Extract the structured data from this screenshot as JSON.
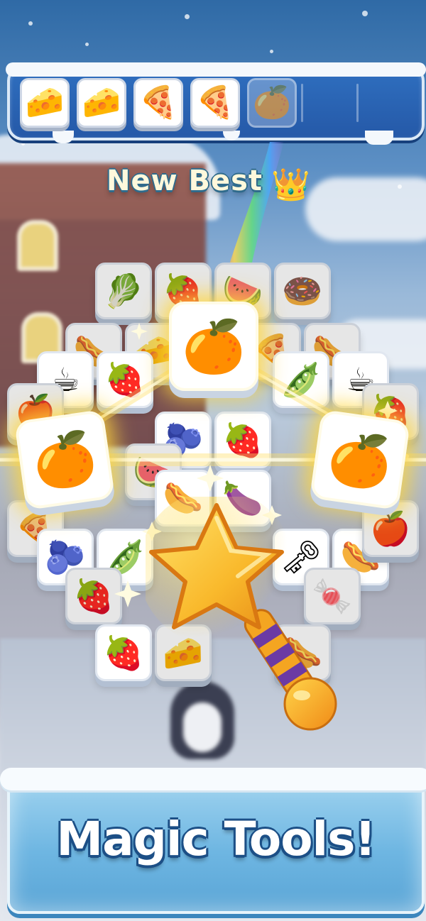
{
  "tray": {
    "slots": [
      {
        "icon": "cheese",
        "glyph": "🧀",
        "state": "filled"
      },
      {
        "icon": "cheese",
        "glyph": "🧀",
        "state": "filled"
      },
      {
        "icon": "pizza",
        "glyph": "🍕",
        "state": "filled"
      },
      {
        "icon": "pizza",
        "glyph": "🍕",
        "state": "filled"
      },
      {
        "icon": "orange",
        "glyph": "🍊",
        "state": "incoming"
      },
      {
        "icon": "empty",
        "glyph": "",
        "state": "empty"
      },
      {
        "icon": "empty",
        "glyph": "",
        "state": "empty"
      }
    ]
  },
  "new_best": {
    "label": "New Best",
    "icon": "crown",
    "glyph": "👑"
  },
  "tiles": [
    {
      "icon": "lettuce",
      "glyph": "🥬"
    },
    {
      "icon": "strawberry",
      "glyph": "🍓"
    },
    {
      "icon": "watermelon",
      "glyph": "🍉"
    },
    {
      "icon": "donut",
      "glyph": "🍩"
    },
    {
      "icon": "hotdog",
      "glyph": "🌭"
    },
    {
      "icon": "cheese",
      "glyph": "🧀"
    },
    {
      "icon": "pizza",
      "glyph": "🍕"
    },
    {
      "icon": "hotdog",
      "glyph": "🌭"
    },
    {
      "icon": "coffee",
      "glyph": "☕"
    },
    {
      "icon": "strawberry",
      "glyph": "🍓"
    },
    {
      "icon": "peas",
      "glyph": "🫛"
    },
    {
      "icon": "coffee",
      "glyph": "☕"
    },
    {
      "icon": "apple",
      "glyph": "🍎"
    },
    {
      "icon": "strawberry",
      "glyph": "🍓"
    },
    {
      "icon": "blueberries",
      "glyph": "🫐"
    },
    {
      "icon": "strawberry",
      "glyph": "🍓"
    },
    {
      "icon": "watermelon",
      "glyph": "🍉"
    },
    {
      "icon": "hotdog",
      "glyph": "🌭"
    },
    {
      "icon": "eggplant",
      "glyph": "🍆"
    },
    {
      "icon": "pizza",
      "glyph": "🍕"
    },
    {
      "icon": "blueberries",
      "glyph": "🫐"
    },
    {
      "icon": "peas",
      "glyph": "🫛"
    },
    {
      "icon": "key",
      "glyph": "🗝"
    },
    {
      "icon": "hotdog",
      "glyph": "🌭"
    },
    {
      "icon": "apple",
      "glyph": "🍎"
    },
    {
      "icon": "strawberry",
      "glyph": "🍓"
    },
    {
      "icon": "candy",
      "glyph": "🍬"
    },
    {
      "icon": "raspberry",
      "glyph": "🍓"
    },
    {
      "icon": "cheese",
      "glyph": "🧀"
    },
    {
      "icon": "hotdog",
      "glyph": "🌭"
    }
  ],
  "highlighted_tiles": [
    {
      "icon": "orange",
      "glyph": "🍊"
    },
    {
      "icon": "orange",
      "glyph": "🍊"
    },
    {
      "icon": "orange",
      "glyph": "🍊"
    }
  ],
  "wand": {
    "icon": "star-magic-wand"
  },
  "banner": {
    "title": "Magic Tools!"
  },
  "colors": {
    "tray": "#2b64b3",
    "banner": "#6eb6e2",
    "glow": "#ffd63c",
    "title_outline": "#1c4f86"
  }
}
